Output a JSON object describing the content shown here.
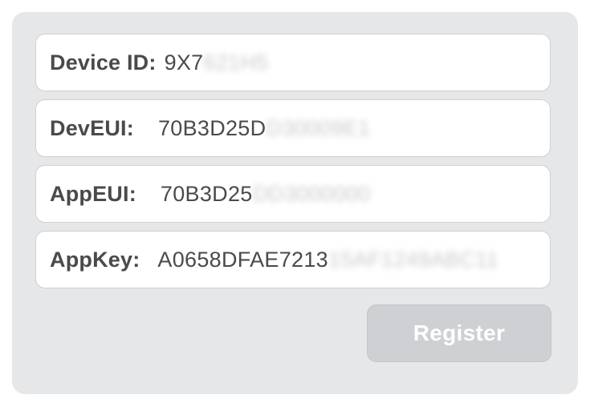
{
  "form": {
    "device_id": {
      "label": "Device ID:",
      "value_visible": "9X7",
      "value_masked": "621H5"
    },
    "dev_eui": {
      "label": "DevEUI:",
      "value_visible": "70B3D25D",
      "value_masked": "D30009E1"
    },
    "app_eui": {
      "label": "AppEUI:",
      "value_visible": "70B3D25",
      "value_masked": "DD3000000"
    },
    "app_key": {
      "label": "AppKey:",
      "value_visible": "A0658DFAE7213",
      "value_masked": "15AF1249ABC11"
    }
  },
  "actions": {
    "register_label": "Register",
    "register_state": "disabled"
  },
  "colors": {
    "panel_bg": "#e6e7e9",
    "field_bg": "#ffffff",
    "text": "#4a4a4a",
    "button_disabled_bg": "#cfd0d3",
    "button_text": "#ffffff"
  }
}
